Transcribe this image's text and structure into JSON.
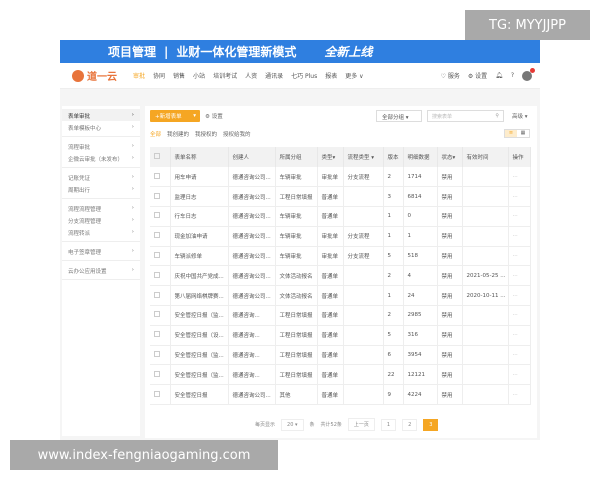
{
  "banner": {
    "title": "项目管理",
    "sep": "|",
    "subtitle": "业财一体化管理新模式",
    "tag": "全新上线"
  },
  "nav": {
    "logo": "道一云",
    "items": [
      "审批",
      "协同",
      "销售",
      "小站",
      "培训考试",
      "人资",
      "通讯录",
      "七巧 Plus",
      "报表",
      "更多 ∨"
    ],
    "right": {
      "service": "服务",
      "settings": "设置"
    }
  },
  "sidebar": {
    "groups": [
      [
        "表单审批",
        "表单模板中心"
      ],
      [
        "流程审批",
        "企微云审批（未发布）"
      ],
      [
        "记账凭证",
        "周期出行"
      ],
      [
        "流程流程管理",
        "分支流程管理",
        "流程转派"
      ],
      [
        "电子签章管理"
      ],
      [
        "云办公应用设置"
      ]
    ]
  },
  "toolbar": {
    "new_button": "+新增表单",
    "settings": "设置",
    "group_select": "全部分组",
    "search_placeholder": "搜索表单",
    "advanced": "高级"
  },
  "filters": [
    "全部",
    "我创建的",
    "我授权的",
    "授权给我的"
  ],
  "table": {
    "headers": [
      "表单名称",
      "创建人",
      "所属分组",
      "类型▾",
      "流程类型 ▾",
      "版本",
      "明细数据",
      "状态▾",
      "有效时间",
      "操作"
    ],
    "rows": [
      [
        "用车申请",
        "德通咨询公司...",
        "车辆审批",
        "审批单",
        "分支流程",
        "2",
        "1714",
        "禁用",
        ""
      ],
      [
        "监理日志",
        "德通咨询公司...",
        "工程日常填报",
        "普通单",
        "",
        "3",
        "6814",
        "禁用",
        ""
      ],
      [
        "行车日志",
        "德通咨询公司...",
        "车辆审批",
        "普通单",
        "",
        "1",
        "0",
        "禁用",
        ""
      ],
      [
        "现金加油申请",
        "德通咨询公司...",
        "车辆审批",
        "审批单",
        "分支流程",
        "1",
        "1",
        "禁用",
        ""
      ],
      [
        "车辆派修单",
        "德通咨询公司...",
        "车辆审批",
        "审批单",
        "分支流程",
        "5",
        "518",
        "禁用",
        ""
      ],
      [
        "庆祝中国共产党成...",
        "德通咨询公司...",
        "文体活动报名",
        "普通单",
        "",
        "2",
        "4",
        "禁用",
        "2021-05-25 ..."
      ],
      [
        "第八届网络棋牌赛...",
        "德通咨询公司...",
        "文体活动报名",
        "普通单",
        "",
        "1",
        "24",
        "禁用",
        "2020-10-11 ..."
      ],
      [
        "安全管控日报（监...",
        "德通咨询...",
        "工程日常填报",
        "普通单",
        "",
        "2",
        "2985",
        "禁用",
        ""
      ],
      [
        "安全管控日报（设...",
        "德通咨询...",
        "工程日常填报",
        "普通单",
        "",
        "5",
        "316",
        "禁用",
        ""
      ],
      [
        "安全管控日报（监...",
        "德通咨询...",
        "工程日常填报",
        "普通单",
        "",
        "6",
        "3954",
        "禁用",
        ""
      ],
      [
        "安全管控日报（监...",
        "德通咨询...",
        "工程日常填报",
        "普通单",
        "",
        "22",
        "12121",
        "禁用",
        ""
      ],
      [
        "安全管控日报",
        "德通咨询公司...",
        "其他",
        "普通单",
        "",
        "9",
        "4224",
        "禁用",
        ""
      ]
    ],
    "action": "···"
  },
  "pager": {
    "per_page_label": "每页显示",
    "per_page": "20",
    "unit": "条",
    "total": "共计52条",
    "prev": "上一页",
    "pages": [
      "1",
      "2",
      "3"
    ],
    "current": "3"
  },
  "overlays": {
    "tg": "TG: MYYJJPP",
    "watermark": "www.index-fengniaogaming.com"
  },
  "colors": {
    "banner": "#2f7fe0",
    "accent": "#f5a623"
  }
}
